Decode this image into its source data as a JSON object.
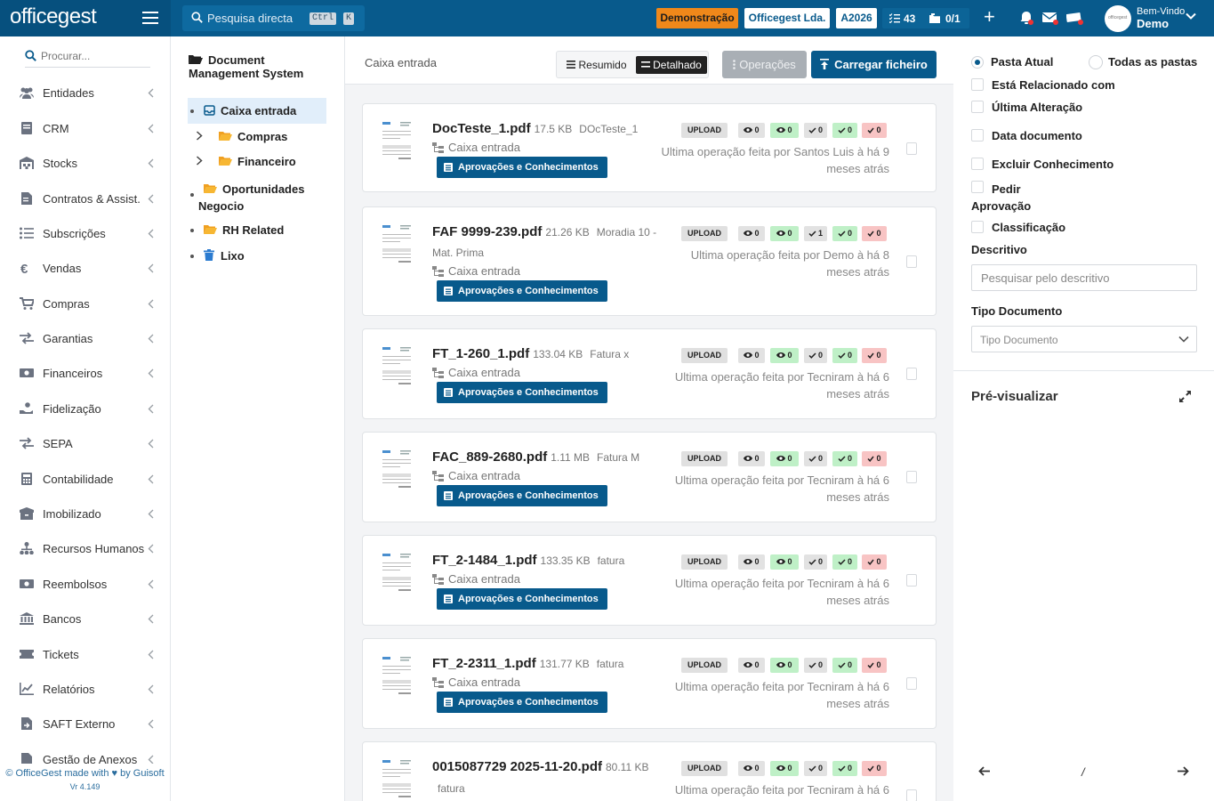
{
  "topbar": {
    "logo": "officegest",
    "search_placeholder": "Pesquisa directa",
    "kbd_ctrl": "Ctrl",
    "kbd_k": "K",
    "demo_label": "Demonstração",
    "company_label": "Officegest Lda.",
    "year_label": "A2026",
    "tasks_count": "43",
    "folders_count": "0/1",
    "user_greeting": "Bem-Vindo",
    "user_name": "Demo"
  },
  "sidebar": {
    "search_placeholder": "Procurar...",
    "items": [
      {
        "label": "Entidades",
        "icon": "users-icon"
      },
      {
        "label": "CRM",
        "icon": "book-icon"
      },
      {
        "label": "Stocks",
        "icon": "warehouse-icon"
      },
      {
        "label": "Contratos & Assist.",
        "icon": "contract-icon"
      },
      {
        "label": "Subscrições",
        "icon": "list-icon"
      },
      {
        "label": "Vendas",
        "icon": "euro-icon"
      },
      {
        "label": "Compras",
        "icon": "cart-icon"
      },
      {
        "label": "Garantias",
        "icon": "exchange-icon"
      },
      {
        "label": "Financeiros",
        "icon": "money-icon"
      },
      {
        "label": "Fidelização",
        "icon": "hand-coin-icon"
      },
      {
        "label": "SEPA",
        "icon": "exchange-icon"
      },
      {
        "label": "Contabilidade",
        "icon": "calculator-icon"
      },
      {
        "label": "Imobilizado",
        "icon": "box-icon"
      },
      {
        "label": "Recursos Humanos",
        "icon": "org-chart-icon"
      },
      {
        "label": "Reembolsos",
        "icon": "money-icon"
      },
      {
        "label": "Bancos",
        "icon": "bank-icon"
      },
      {
        "label": "Tickets",
        "icon": "ticket-icon"
      },
      {
        "label": "Relatórios",
        "icon": "chart-icon"
      },
      {
        "label": "SAFT Externo",
        "icon": "export-icon"
      },
      {
        "label": "Gestão de Anexos",
        "icon": "attachment-icon"
      }
    ],
    "footer_credit": "© OfficeGest made with ♥ by Guisoft",
    "version": "Vr 4.149"
  },
  "tree": {
    "title": "Document Management System",
    "nodes": {
      "inbox": "Caixa entrada",
      "compras": "Compras",
      "financeiro": "Financeiro",
      "oportunidades": "Oportunidades Negocio",
      "rh": "RH Related",
      "lixo": "Lixo"
    }
  },
  "main": {
    "title": "Caixa entrada",
    "view_resumido": "Resumido",
    "view_detalhado": "Detalhado",
    "operations_label": "Operações",
    "upload_label": "Carregar ficheiro",
    "approvals_label": "Aprovações e Conhecimentos",
    "upload_badge": "UPLOAD",
    "documents": [
      {
        "name": "DocTeste_1.pdf",
        "size": "17.5 KB",
        "desc": "DOcTeste_1",
        "folder": "Caixa entrada",
        "op": "Ultima operação feita por Santos Luis à há 9 meses atrás",
        "b1": "0",
        "b2": "0",
        "b3": "0",
        "b4": "0",
        "b5": "0"
      },
      {
        "name": "FAF 9999-239.pdf",
        "size": "21.26 KB",
        "desc": "Moradia 10 -",
        "desc2": "Mat. Prima",
        "folder": "Caixa entrada",
        "op": "Ultima operação feita por Demo à há 8 meses atrás",
        "b1": "0",
        "b2": "0",
        "b3": "1",
        "b4": "0",
        "b5": "0"
      },
      {
        "name": "FT_1-260_1.pdf",
        "size": "133.04 KB",
        "desc": "Fatura x",
        "folder": "Caixa entrada",
        "op": "Ultima operação feita por Tecniram à há 6 meses atrás",
        "b1": "0",
        "b2": "0",
        "b3": "0",
        "b4": "0",
        "b5": "0"
      },
      {
        "name": "FAC_889-2680.pdf",
        "size": "1.11 MB",
        "desc": "Fatura M",
        "folder": "Caixa entrada",
        "op": "Ultima operação feita por Tecniram à há 6 meses atrás",
        "b1": "0",
        "b2": "0",
        "b3": "0",
        "b4": "0",
        "b5": "0"
      },
      {
        "name": "FT_2-1484_1.pdf",
        "size": "133.35 KB",
        "desc": "fatura",
        "folder": "Caixa entrada",
        "op": "Ultima operação feita por Tecniram à há 6 meses atrás",
        "b1": "0",
        "b2": "0",
        "b3": "0",
        "b4": "0",
        "b5": "0"
      },
      {
        "name": "FT_2-2311_1.pdf",
        "size": "131.77 KB",
        "desc": "fatura",
        "folder": "Caixa entrada",
        "op": "Ultima operação feita por Tecniram à há 6 meses atrás",
        "b1": "0",
        "b2": "0",
        "b3": "0",
        "b4": "0",
        "b5": "0"
      },
      {
        "name": "0015087729 2025-11-20.pdf",
        "size": "80.11 KB",
        "desc2": "fatura",
        "op": "Ultima operação feita por Tecniram à há 6",
        "b1": "0",
        "b2": "0",
        "b3": "0",
        "b4": "0",
        "b5": "0"
      }
    ]
  },
  "filters": {
    "radio_current": "Pasta Atual",
    "radio_all": "Todas as pastas",
    "check_related": "Está Relacionado com",
    "check_last_change": "Última Alteração",
    "check_doc_date": "Data documento",
    "check_exclude": "Excluir Conhecimento",
    "check_request": "Pedir Aprovação",
    "check_classification": "Classificação",
    "desc_label": "Descritivo",
    "desc_placeholder": "Pesquisar pelo descritivo",
    "tipo_label": "Tipo Documento",
    "tipo_placeholder": "Tipo Documento"
  },
  "preview": {
    "title": "Pré-visualizar",
    "page_separator": "/"
  },
  "colors": {
    "brand": "#085a8c",
    "accent_orange": "#f0881a",
    "badge_green": "#bff0c7",
    "badge_red": "#f8c4c4"
  }
}
